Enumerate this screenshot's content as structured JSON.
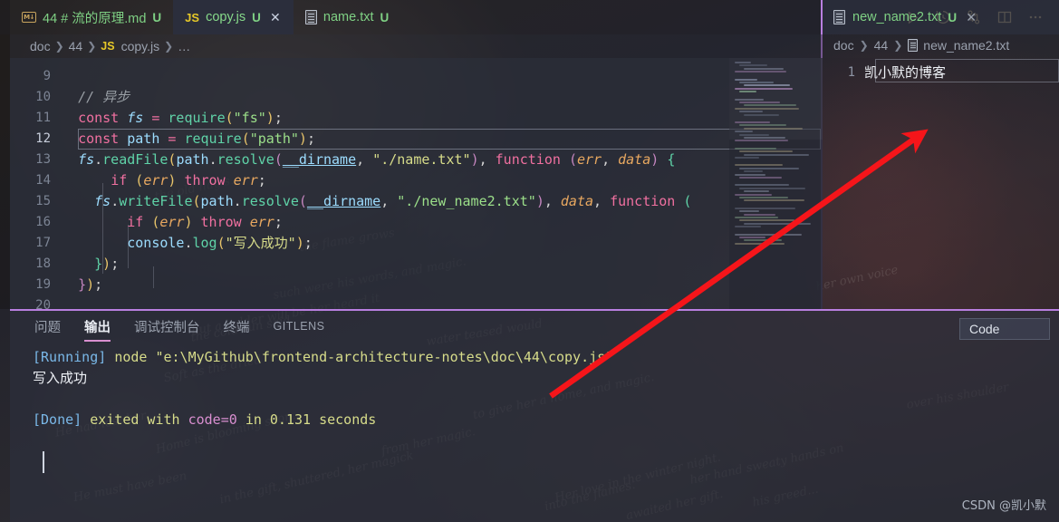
{
  "window": {
    "theme_accent": "#b97fe0",
    "editor_bg": "#2b2e3a",
    "annotation_arrow_color": "#f5151a"
  },
  "tabs": [
    {
      "icon": "markdown-icon",
      "icon_label": "M↓",
      "label": "44 # 流的原理.md",
      "dirty": "U",
      "active": false,
      "closable": false
    },
    {
      "icon": "javascript-icon",
      "icon_label": "JS",
      "label": "copy.js",
      "dirty": "U",
      "active": true,
      "closable": true,
      "close_label": "✕"
    },
    {
      "icon": "text-file-icon",
      "icon_label": "",
      "label": "name.txt",
      "dirty": "U",
      "active": false,
      "closable": false
    }
  ],
  "toolbar": [
    {
      "name": "run-code-button",
      "label": "Run Code"
    },
    {
      "name": "history-button",
      "label": "Timeline / History"
    },
    {
      "name": "source-control-compare-button",
      "label": "Compare Changes"
    },
    {
      "name": "split-editor-button",
      "label": "Split Editor"
    },
    {
      "name": "more-actions-button",
      "label": "…"
    }
  ],
  "right_group": {
    "tab": {
      "icon": "text-file-icon",
      "label": "new_name2.txt",
      "dirty": "U",
      "close_label": "✕"
    },
    "breadcrumb": [
      "doc",
      "44",
      "new_name2.txt"
    ],
    "line_number": "1",
    "content": "凯小默的博客"
  },
  "breadcrumb": {
    "items": [
      "doc",
      "44",
      "copy.js",
      "…"
    ],
    "js_badge": "JS",
    "separator": "›"
  },
  "code": {
    "active_line": 12,
    "lines": [
      {
        "n": "9",
        "tokens": []
      },
      {
        "n": "10",
        "tokens": [
          {
            "t": "  ",
            "c": "op"
          },
          {
            "t": "// 异步",
            "c": "cmt"
          }
        ]
      },
      {
        "n": "11",
        "tokens": [
          {
            "t": "  ",
            "c": "op"
          },
          {
            "t": "const",
            "c": "kw2"
          },
          {
            "t": " ",
            "c": "op"
          },
          {
            "t": "fs",
            "c": "var"
          },
          {
            "t": " ",
            "c": "op"
          },
          {
            "t": "=",
            "c": "kw2"
          },
          {
            "t": " ",
            "c": "op"
          },
          {
            "t": "require",
            "c": "fn"
          },
          {
            "t": "(",
            "c": "par1"
          },
          {
            "t": "\"fs\"",
            "c": "str2"
          },
          {
            "t": ")",
            "c": "par1"
          },
          {
            "t": ";",
            "c": "pn"
          }
        ]
      },
      {
        "n": "12",
        "tokens": [
          {
            "t": "  ",
            "c": "op"
          },
          {
            "t": "const",
            "c": "kw2"
          },
          {
            "t": " ",
            "c": "op"
          },
          {
            "t": "path",
            "c": "var2"
          },
          {
            "t": " ",
            "c": "op"
          },
          {
            "t": "=",
            "c": "kw2"
          },
          {
            "t": " ",
            "c": "op"
          },
          {
            "t": "require",
            "c": "fn"
          },
          {
            "t": "(",
            "c": "par1"
          },
          {
            "t": "\"path\"",
            "c": "str2"
          },
          {
            "t": ")",
            "c": "par1"
          },
          {
            "t": ";",
            "c": "pn"
          }
        ]
      },
      {
        "n": "13",
        "tokens": [
          {
            "t": "  ",
            "c": "op"
          },
          {
            "t": "fs",
            "c": "var"
          },
          {
            "t": ".",
            "c": "pn"
          },
          {
            "t": "readFile",
            "c": "fn"
          },
          {
            "t": "(",
            "c": "par1"
          },
          {
            "t": "path",
            "c": "obj"
          },
          {
            "t": ".",
            "c": "pn"
          },
          {
            "t": "resolve",
            "c": "fn"
          },
          {
            "t": "(",
            "c": "par2"
          },
          {
            "t": "__dirname",
            "c": "dirn"
          },
          {
            "t": ", ",
            "c": "pn"
          },
          {
            "t": "\"./name.txt\"",
            "c": "str"
          },
          {
            "t": ")",
            "c": "par2"
          },
          {
            "t": ", ",
            "c": "pn"
          },
          {
            "t": "function",
            "c": "kw2"
          },
          {
            "t": " ",
            "c": "op"
          },
          {
            "t": "(",
            "c": "par2"
          },
          {
            "t": "err",
            "c": "prm"
          },
          {
            "t": ", ",
            "c": "pn"
          },
          {
            "t": "data",
            "c": "prm"
          },
          {
            "t": ")",
            "c": "par2"
          },
          {
            "t": " ",
            "c": "op"
          },
          {
            "t": "{",
            "c": "par3"
          }
        ]
      },
      {
        "n": "14",
        "tokens": [
          {
            "t": "      ",
            "c": "op"
          },
          {
            "t": "if",
            "c": "kw2"
          },
          {
            "t": " ",
            "c": "op"
          },
          {
            "t": "(",
            "c": "par1"
          },
          {
            "t": "err",
            "c": "prm"
          },
          {
            "t": ")",
            "c": "par1"
          },
          {
            "t": " ",
            "c": "op"
          },
          {
            "t": "throw",
            "c": "kw2"
          },
          {
            "t": " ",
            "c": "op"
          },
          {
            "t": "err",
            "c": "prm"
          },
          {
            "t": ";",
            "c": "pn"
          }
        ]
      },
      {
        "n": "15",
        "tokens": [
          {
            "t": "    ",
            "c": "op"
          },
          {
            "t": "fs",
            "c": "var"
          },
          {
            "t": ".",
            "c": "pn"
          },
          {
            "t": "writeFile",
            "c": "fn"
          },
          {
            "t": "(",
            "c": "par1"
          },
          {
            "t": "path",
            "c": "obj"
          },
          {
            "t": ".",
            "c": "pn"
          },
          {
            "t": "resolve",
            "c": "fn"
          },
          {
            "t": "(",
            "c": "par2"
          },
          {
            "t": "__dirname",
            "c": "dirn"
          },
          {
            "t": ", ",
            "c": "pn"
          },
          {
            "t": "\"./new_name2.txt\"",
            "c": "str2"
          },
          {
            "t": ")",
            "c": "par2"
          },
          {
            "t": ", ",
            "c": "pn"
          },
          {
            "t": "data",
            "c": "prm"
          },
          {
            "t": ", ",
            "c": "pn"
          },
          {
            "t": "function",
            "c": "kw2"
          },
          {
            "t": " ",
            "c": "op"
          },
          {
            "t": "(",
            "c": "par3"
          }
        ]
      },
      {
        "n": "16",
        "tokens": [
          {
            "t": "        ",
            "c": "op"
          },
          {
            "t": "if",
            "c": "kw2"
          },
          {
            "t": " ",
            "c": "op"
          },
          {
            "t": "(",
            "c": "par1"
          },
          {
            "t": "err",
            "c": "prm"
          },
          {
            "t": ")",
            "c": "par1"
          },
          {
            "t": " ",
            "c": "op"
          },
          {
            "t": "throw",
            "c": "kw2"
          },
          {
            "t": " ",
            "c": "op"
          },
          {
            "t": "err",
            "c": "prm"
          },
          {
            "t": ";",
            "c": "pn"
          }
        ]
      },
      {
        "n": "17",
        "tokens": [
          {
            "t": "        ",
            "c": "op"
          },
          {
            "t": "console",
            "c": "obj"
          },
          {
            "t": ".",
            "c": "pn"
          },
          {
            "t": "log",
            "c": "fn"
          },
          {
            "t": "(",
            "c": "par1"
          },
          {
            "t": "\"写入成功\"",
            "c": "str"
          },
          {
            "t": ")",
            "c": "par1"
          },
          {
            "t": ";",
            "c": "pn"
          }
        ]
      },
      {
        "n": "18",
        "tokens": [
          {
            "t": "    ",
            "c": "op"
          },
          {
            "t": "}",
            "c": "par3"
          },
          {
            "t": ")",
            "c": "par1"
          },
          {
            "t": ";",
            "c": "pn"
          }
        ]
      },
      {
        "n": "19",
        "tokens": [
          {
            "t": "  ",
            "c": "op"
          },
          {
            "t": "}",
            "c": "par2"
          },
          {
            "t": ")",
            "c": "par1"
          },
          {
            "t": ";",
            "c": "pn"
          }
        ]
      },
      {
        "n": "20",
        "tokens": []
      }
    ]
  },
  "panel": {
    "tabs": [
      {
        "label": "问题",
        "active": false,
        "small": false
      },
      {
        "label": "输出",
        "active": true,
        "small": false
      },
      {
        "label": "调试控制台",
        "active": false,
        "small": false
      },
      {
        "label": "终端",
        "active": false,
        "small": false
      },
      {
        "label": "GITLENS",
        "active": false,
        "small": true
      }
    ],
    "channel": {
      "value": "Code",
      "name": "output-channel-select"
    },
    "output": {
      "running_tag": "[Running]",
      "running_cmd": "node",
      "running_path": "\"e:\\MyGithub\\frontend-architecture-notes\\doc\\44\\copy.js\"",
      "result_text": "写入成功",
      "done_tag": "[Done]",
      "done_mid": "exited with",
      "done_code": "code=0",
      "done_in": "in",
      "done_time": "0.131",
      "done_unit": "seconds"
    }
  },
  "watermark": "CSDN @凯小默"
}
